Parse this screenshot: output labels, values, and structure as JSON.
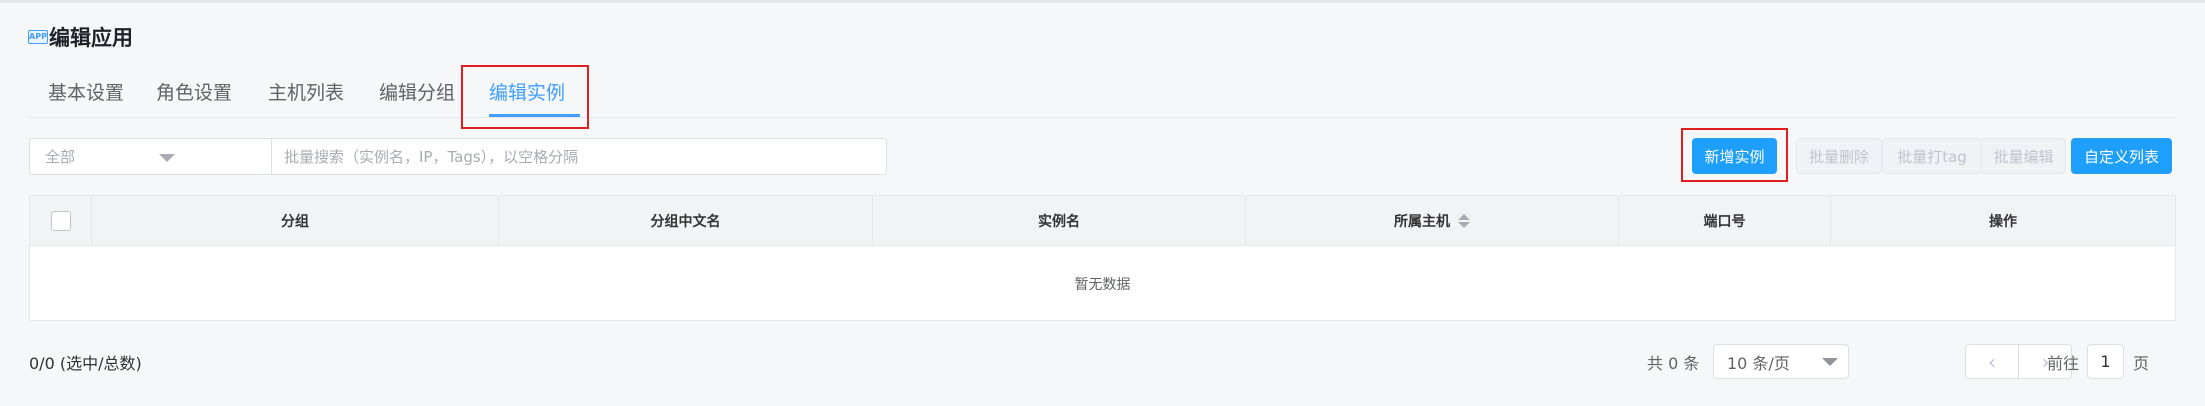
{
  "page": {
    "icon_text": "APP",
    "title": "编辑应用"
  },
  "tabs": [
    {
      "label": "基本设置"
    },
    {
      "label": "角色设置"
    },
    {
      "label": "主机列表"
    },
    {
      "label": "编辑分组"
    },
    {
      "label": "编辑实例",
      "active": true
    }
  ],
  "filter": {
    "selected": "全部"
  },
  "search": {
    "placeholder": "批量搜索（实例名，IP，Tags），以空格分隔",
    "value": ""
  },
  "actions": {
    "add": "新增实例",
    "batch_delete": "批量删除",
    "batch_tag": "批量打tag",
    "batch_edit": "批量编辑",
    "custom_columns": "自定义列表"
  },
  "table": {
    "columns": [
      "分组",
      "分组中文名",
      "实例名",
      "所属主机",
      "端口号",
      "操作"
    ],
    "sortable_column": "所属主机",
    "rows": [],
    "empty_text": "暂无数据"
  },
  "footer": {
    "selected_count": "0/0 (选中/总数)",
    "total": "共 0 条",
    "page_size": "10 条/页",
    "prev_icon": "‹",
    "next_icon": "›",
    "goto_label": "前往",
    "current_page": "1",
    "page_suffix": "页"
  },
  "colors": {
    "accent": "#409eff",
    "primary_button": "#1f9ffc",
    "highlight_box": "#e02020"
  }
}
